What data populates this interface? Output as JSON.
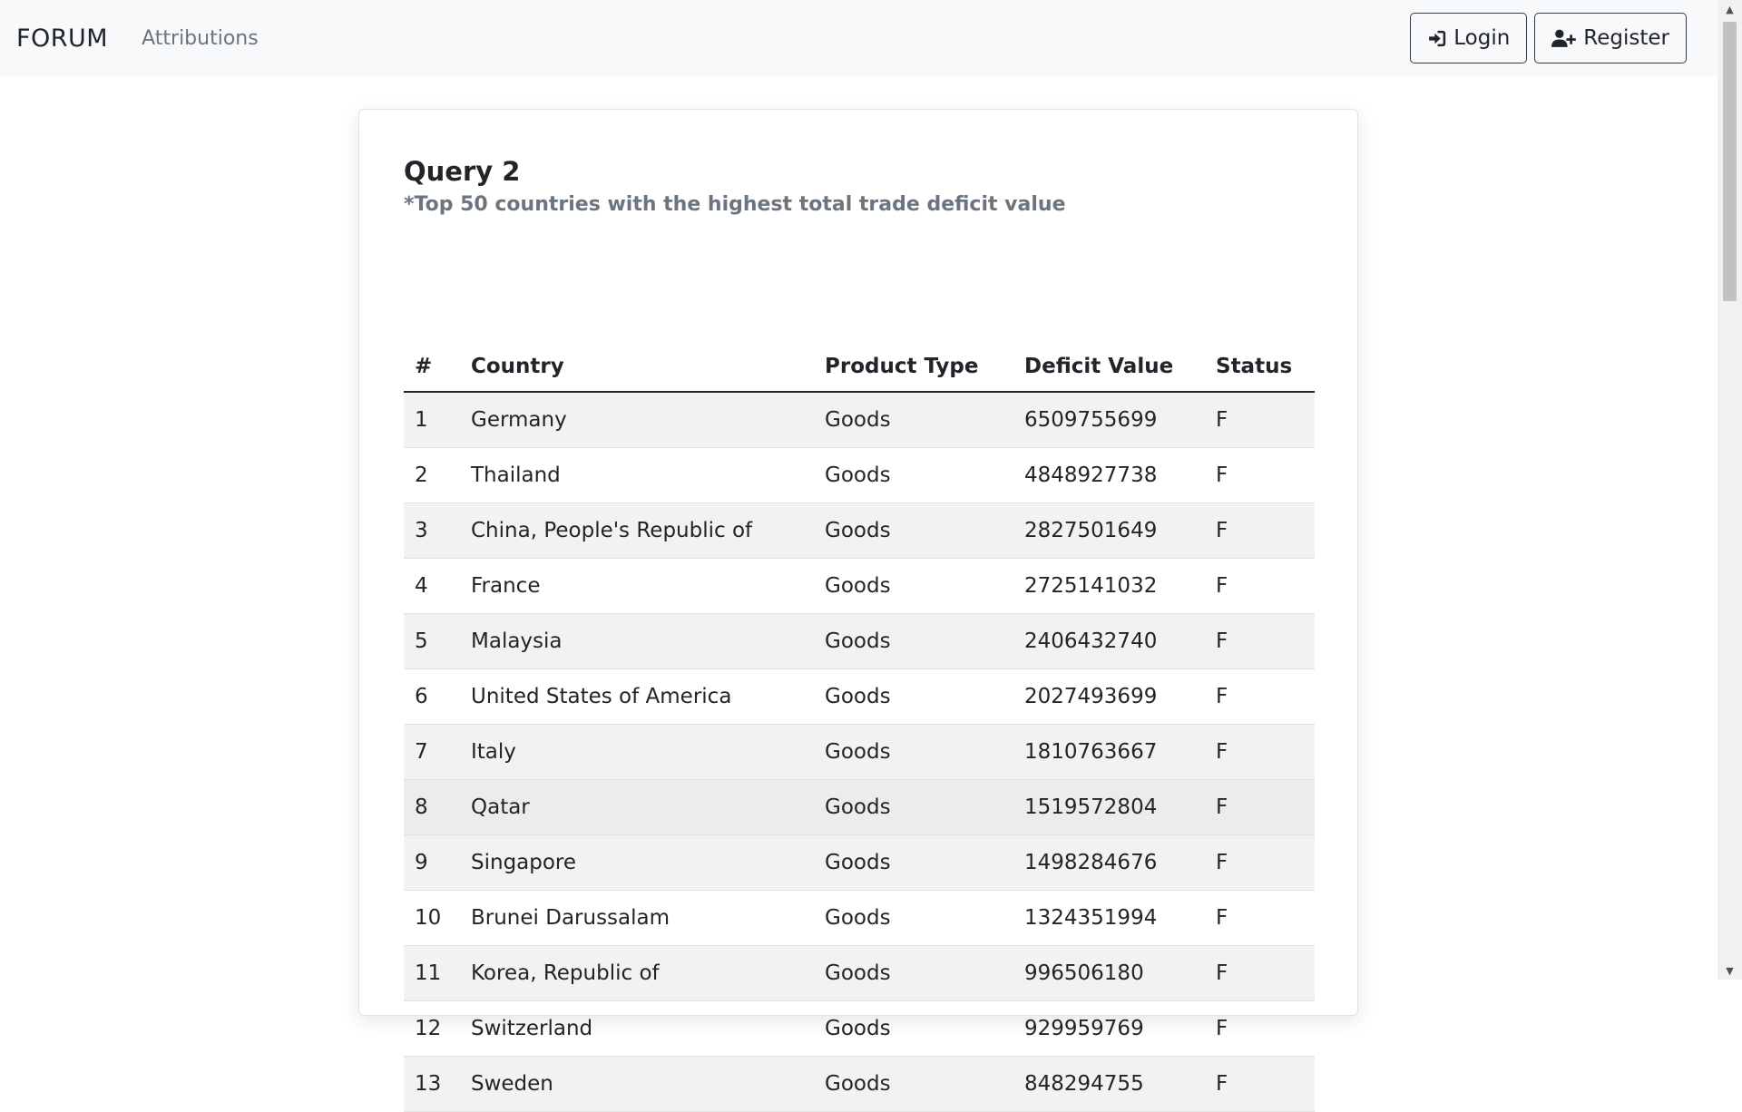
{
  "navbar": {
    "brand": "FORUM",
    "links": [
      "Attributions"
    ],
    "login_label": "Login",
    "register_label": "Register"
  },
  "card": {
    "title": "Query 2",
    "subtitle": "*Top 50 countries with the highest total trade deficit value"
  },
  "table": {
    "headers": [
      "#",
      "Country",
      "Product Type",
      "Deficit Value",
      "Status"
    ],
    "rows": [
      [
        "1",
        "Germany",
        "Goods",
        "6509755699",
        "F"
      ],
      [
        "2",
        "Thailand",
        "Goods",
        "4848927738",
        "F"
      ],
      [
        "3",
        "China, People's Republic of",
        "Goods",
        "2827501649",
        "F"
      ],
      [
        "4",
        "France",
        "Goods",
        "2725141032",
        "F"
      ],
      [
        "5",
        "Malaysia",
        "Goods",
        "2406432740",
        "F"
      ],
      [
        "6",
        "United States of America",
        "Goods",
        "2027493699",
        "F"
      ],
      [
        "7",
        "Italy",
        "Goods",
        "1810763667",
        "F"
      ],
      [
        "8",
        "Qatar",
        "Goods",
        "1519572804",
        "F"
      ],
      [
        "9",
        "Singapore",
        "Goods",
        "1498284676",
        "F"
      ],
      [
        "10",
        "Brunei Darussalam",
        "Goods",
        "1324351994",
        "F"
      ],
      [
        "11",
        "Korea, Republic of",
        "Goods",
        "996506180",
        "F"
      ],
      [
        "12",
        "Switzerland",
        "Goods",
        "929959769",
        "F"
      ],
      [
        "13",
        "Sweden",
        "Goods",
        "848294755",
        "F"
      ]
    ]
  },
  "icons": {
    "login": "sign-in-icon",
    "register": "user-plus-icon"
  },
  "colors": {
    "navbar_bg": "#f8f9fa",
    "subtitle": "#6c757d",
    "row_stripe": "#f2f2f2"
  }
}
